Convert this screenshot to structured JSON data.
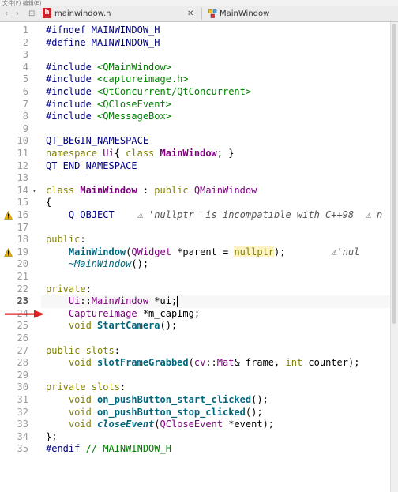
{
  "window": {
    "title_fragment": "文件(F) 编辑(E)"
  },
  "tabbar": {
    "nav_back": "‹",
    "nav_forward": "›",
    "menu_glyph": "⊡",
    "file_icon_letter": "h",
    "file_name": "mainwindow.h",
    "close_glyph": "✕",
    "symbol_name": "MainWindow",
    "symbol_icon": "class-icon"
  },
  "colors": {
    "keyword": "#808000",
    "type": "#800080",
    "macro": "#000080",
    "include": "#008000",
    "warning": "#e5b000",
    "arrow": "#e02020"
  },
  "editor": {
    "current_line": 23,
    "line_numbers": [
      "1",
      "2",
      "3",
      "4",
      "5",
      "6",
      "7",
      "8",
      "9",
      "10",
      "11",
      "12",
      "13",
      "14",
      "15",
      "16",
      "17",
      "18",
      "19",
      "20",
      "21",
      "22",
      "23",
      "24",
      "25",
      "26",
      "27",
      "28",
      "29",
      "30",
      "31",
      "32",
      "33",
      "34",
      "35"
    ],
    "warning_lines": [
      16,
      19
    ],
    "fold_marker_line": 14,
    "fold_marker": "▾",
    "lines": [
      [
        [
          "pp",
          "#ifndef MAINWINDOW_H"
        ]
      ],
      [
        [
          "pp",
          "#define MAINWINDOW_H"
        ]
      ],
      [],
      [
        [
          "pp",
          "#include "
        ],
        [
          "inc",
          "<QMainWindow>"
        ]
      ],
      [
        [
          "pp",
          "#include "
        ],
        [
          "inc",
          "<captureimage.h>"
        ]
      ],
      [
        [
          "pp",
          "#include "
        ],
        [
          "inc",
          "<QtConcurrent/QtConcurrent>"
        ]
      ],
      [
        [
          "pp",
          "#include "
        ],
        [
          "inc",
          "<QCloseEvent>"
        ]
      ],
      [
        [
          "pp",
          "#include "
        ],
        [
          "inc",
          "<QMessageBox>"
        ]
      ],
      [],
      [
        [
          "mac",
          "QT_BEGIN_NAMESPACE"
        ]
      ],
      [
        [
          "kw",
          "namespace "
        ],
        [
          "ty",
          "Ui"
        ],
        [
          "",
          "{ "
        ],
        [
          "kw",
          "class "
        ],
        [
          "ty b",
          "MainWindow"
        ],
        [
          "",
          "; }"
        ]
      ],
      [
        [
          "mac",
          "QT_END_NAMESPACE"
        ]
      ],
      [],
      [
        [
          "kw",
          "class "
        ],
        [
          "ty b",
          "MainWindow"
        ],
        [
          "",
          " : "
        ],
        [
          "kw",
          "public "
        ],
        [
          "ty",
          "QMainWindow"
        ]
      ],
      [
        [
          "",
          "{"
        ]
      ],
      [
        [
          "",
          "    "
        ],
        [
          "mac",
          "Q_OBJECT"
        ],
        [
          "",
          "    "
        ],
        [
          "diag",
          "⚠ 'nullptr' is incompatible with C++98  ⚠'n"
        ]
      ],
      [],
      [
        [
          "kw",
          "public"
        ],
        [
          "",
          ":"
        ]
      ],
      [
        [
          "",
          "    "
        ],
        [
          "def",
          "MainWindow"
        ],
        [
          "",
          "("
        ],
        [
          "ty",
          "QWidget"
        ],
        [
          "",
          " *parent = "
        ],
        [
          "kw hl-null",
          "nullptr"
        ],
        [
          "",
          ");"
        ],
        [
          "",
          "        "
        ],
        [
          "diag",
          "⚠'nul"
        ]
      ],
      [
        [
          "",
          "    "
        ],
        [
          "fn it",
          "~MainWindow"
        ],
        [
          "",
          "();"
        ]
      ],
      [],
      [
        [
          "kw",
          "private"
        ],
        [
          "",
          ":"
        ]
      ],
      [
        [
          "",
          "    "
        ],
        [
          "ty",
          "Ui"
        ],
        [
          "",
          "::"
        ],
        [
          "ty",
          "MainWindow"
        ],
        [
          "",
          " *ui;"
        ]
      ],
      [
        [
          "",
          "    "
        ],
        [
          "ty",
          "CaptureImage"
        ],
        [
          "",
          " *m_capImg;"
        ]
      ],
      [
        [
          "",
          "    "
        ],
        [
          "kw",
          "void "
        ],
        [
          "def",
          "StartCamera"
        ],
        [
          "",
          "();"
        ]
      ],
      [],
      [
        [
          "kw",
          "public slots"
        ],
        [
          "",
          ":"
        ]
      ],
      [
        [
          "",
          "    "
        ],
        [
          "kw",
          "void "
        ],
        [
          "def",
          "slotFrameGrabbed"
        ],
        [
          "",
          "("
        ],
        [
          "ty",
          "cv"
        ],
        [
          "",
          "::"
        ],
        [
          "ty",
          "Mat"
        ],
        [
          "",
          "& frame, "
        ],
        [
          "kw",
          "int"
        ],
        [
          "",
          " counter);"
        ]
      ],
      [],
      [
        [
          "kw",
          "private slots"
        ],
        [
          "",
          ":"
        ]
      ],
      [
        [
          "",
          "    "
        ],
        [
          "kw",
          "void "
        ],
        [
          "def",
          "on_pushButton_start_clicked"
        ],
        [
          "",
          "();"
        ]
      ],
      [
        [
          "",
          "    "
        ],
        [
          "kw",
          "void "
        ],
        [
          "def",
          "on_pushButton_stop_clicked"
        ],
        [
          "",
          "();"
        ]
      ],
      [
        [
          "",
          "    "
        ],
        [
          "kw",
          "void "
        ],
        [
          "def it",
          "closeEvent"
        ],
        [
          "",
          "("
        ],
        [
          "ty",
          "QCloseEvent"
        ],
        [
          "",
          " *event);"
        ]
      ],
      [
        [
          "",
          "};"
        ]
      ],
      [
        [
          "pp",
          "#endif "
        ],
        [
          "cm",
          "// MAINWINDOW_H"
        ]
      ],
      []
    ]
  },
  "annotation": {
    "arrow_line": 24
  }
}
